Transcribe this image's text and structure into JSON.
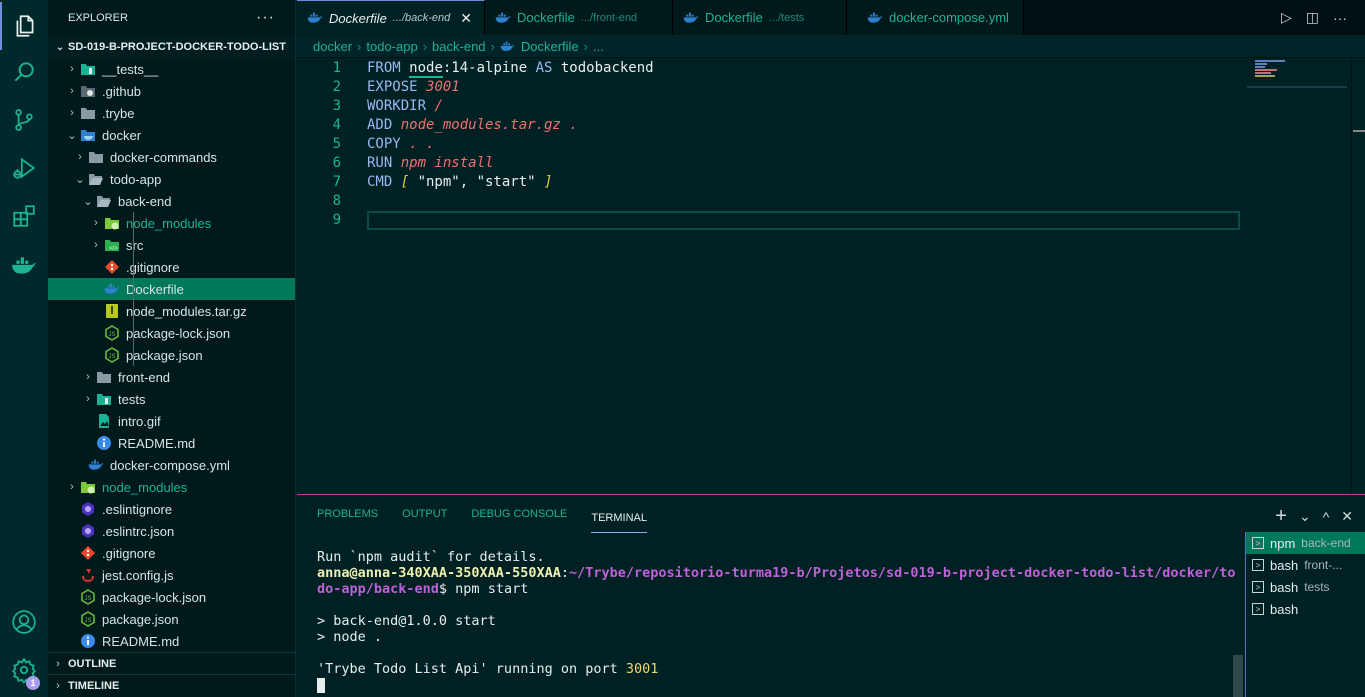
{
  "activity_bar": {
    "items": [
      {
        "name": "explorer",
        "icon": "files-icon"
      },
      {
        "name": "search",
        "icon": "search-icon"
      },
      {
        "name": "source-control",
        "icon": "source-control-icon"
      },
      {
        "name": "run-debug",
        "icon": "run-debug-icon"
      },
      {
        "name": "extensions",
        "icon": "extensions-icon"
      },
      {
        "name": "docker",
        "icon": "docker-icon"
      }
    ],
    "bottom": [
      {
        "name": "accounts",
        "icon": "account-icon"
      },
      {
        "name": "manage",
        "icon": "gear-icon",
        "badge": "1"
      }
    ]
  },
  "sidebar": {
    "title": "EXPLORER",
    "more": "···",
    "project": "SD-019-B-PROJECT-DOCKER-TODO-LIST",
    "tree": [
      {
        "label": "__tests__",
        "depth": 0,
        "type": "folder-test",
        "expanded": false
      },
      {
        "label": ".github",
        "depth": 0,
        "type": "folder-github",
        "expanded": false
      },
      {
        "label": ".trybe",
        "depth": 0,
        "type": "folder",
        "expanded": false
      },
      {
        "label": "docker",
        "depth": 0,
        "type": "folder-docker",
        "expanded": true
      },
      {
        "label": "docker-commands",
        "depth": 1,
        "type": "folder",
        "expanded": false
      },
      {
        "label": "todo-app",
        "depth": 1,
        "type": "folder-open",
        "expanded": true
      },
      {
        "label": "back-end",
        "depth": 2,
        "type": "folder-open",
        "expanded": true
      },
      {
        "label": "node_modules",
        "depth": 3,
        "type": "folder-node",
        "expanded": false,
        "green": true
      },
      {
        "label": "src",
        "depth": 3,
        "type": "folder-src",
        "expanded": false
      },
      {
        "label": ".gitignore",
        "depth": 3,
        "type": "git"
      },
      {
        "label": "Dockerfile",
        "depth": 3,
        "type": "docker",
        "selected": true
      },
      {
        "label": "node_modules.tar.gz",
        "depth": 3,
        "type": "zip"
      },
      {
        "label": "package-lock.json",
        "depth": 3,
        "type": "node"
      },
      {
        "label": "package.json",
        "depth": 3,
        "type": "node"
      },
      {
        "label": "front-end",
        "depth": 2,
        "type": "folder",
        "expanded": false
      },
      {
        "label": "tests",
        "depth": 2,
        "type": "folder-test",
        "expanded": false
      },
      {
        "label": "intro.gif",
        "depth": 2,
        "type": "image"
      },
      {
        "label": "README.md",
        "depth": 2,
        "type": "info"
      },
      {
        "label": "docker-compose.yml",
        "depth": 1,
        "type": "docker"
      },
      {
        "label": "node_modules",
        "depth": 0,
        "type": "folder-node",
        "expanded": false,
        "green": true
      },
      {
        "label": ".eslintignore",
        "depth": 0,
        "type": "eslint"
      },
      {
        "label": ".eslintrc.json",
        "depth": 0,
        "type": "eslint"
      },
      {
        "label": ".gitignore",
        "depth": 0,
        "type": "git"
      },
      {
        "label": "jest.config.js",
        "depth": 0,
        "type": "jest"
      },
      {
        "label": "package-lock.json",
        "depth": 0,
        "type": "node"
      },
      {
        "label": "package.json",
        "depth": 0,
        "type": "node"
      },
      {
        "label": "README.md",
        "depth": 0,
        "type": "info"
      }
    ],
    "sections": [
      "OUTLINE",
      "TIMELINE"
    ]
  },
  "tabs": [
    {
      "label": "Dockerfile",
      "dir": ".../back-end",
      "active": true,
      "close": "✕"
    },
    {
      "label": "Dockerfile",
      "dir": ".../front-end",
      "active": false
    },
    {
      "label": "Dockerfile",
      "dir": ".../tests",
      "active": false
    },
    {
      "label": "docker-compose.yml",
      "dir": "",
      "active": false
    }
  ],
  "breadcrumb": [
    "docker",
    "todo-app",
    "back-end",
    "Dockerfile",
    "..."
  ],
  "editor": {
    "lines": [
      {
        "n": "1",
        "tokens": [
          [
            "kw",
            "FROM "
          ],
          [
            "ul",
            "node"
          ],
          [
            "str",
            ":14-alpine "
          ],
          [
            "kw",
            "AS"
          ],
          [
            "str",
            " todobackend"
          ]
        ]
      },
      {
        "n": "2",
        "tokens": [
          [
            "kw",
            "EXPOSE "
          ],
          [
            "it",
            "3001"
          ]
        ]
      },
      {
        "n": "3",
        "tokens": [
          [
            "kw",
            "WORKDIR "
          ],
          [
            "it",
            "/"
          ]
        ]
      },
      {
        "n": "4",
        "tokens": [
          [
            "kw",
            "ADD "
          ],
          [
            "it",
            "node_modules.tar.gz ."
          ]
        ]
      },
      {
        "n": "5",
        "tokens": [
          [
            "kw",
            "COPY "
          ],
          [
            "it",
            ". ."
          ]
        ]
      },
      {
        "n": "6",
        "tokens": [
          [
            "kw",
            "RUN "
          ],
          [
            "it",
            "npm install"
          ]
        ]
      },
      {
        "n": "7",
        "tokens": [
          [
            "kw",
            "CMD "
          ],
          [
            "br",
            "[ "
          ],
          [
            "str",
            "\"npm\", \"start\" "
          ],
          [
            "br",
            "]"
          ]
        ]
      },
      {
        "n": "8",
        "tokens": []
      },
      {
        "n": "9",
        "tokens": []
      }
    ]
  },
  "panel": {
    "tabs": [
      "PROBLEMS",
      "OUTPUT",
      "DEBUG CONSOLE",
      "TERMINAL"
    ],
    "active_tab": "TERMINAL",
    "actions": {
      "add": "+",
      "dropdown": "⌄",
      "maximize": "^",
      "close": "✕"
    },
    "terminal": {
      "line1": "Run `npm audit` for details.",
      "prompt_user": "anna@anna-340XAA-350XAA-550XAA",
      "prompt_path_1": "~/Trybe/repositorio-turma19-b/Projetos/sd-019-b-project-docker-todo-list/docker/to",
      "prompt_path_2": "do-app/back-end",
      "command": "$ npm start",
      "out1": "> back-end@1.0.0 start",
      "out2": "> node .",
      "out3_prefix": "'Trybe Todo List Api' running on port ",
      "out3_port": "3001"
    },
    "terminals": [
      {
        "name": "npm",
        "sub": "back-end",
        "active": true
      },
      {
        "name": "bash",
        "sub": "front-...",
        "active": false
      },
      {
        "name": "bash",
        "sub": "tests",
        "active": false
      },
      {
        "name": "bash",
        "sub": "",
        "active": false
      }
    ]
  }
}
